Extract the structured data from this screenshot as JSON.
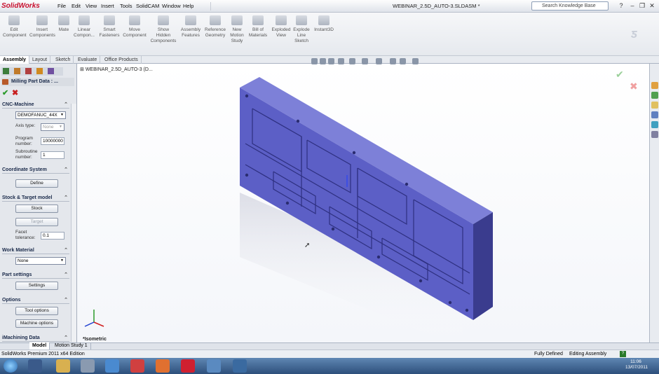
{
  "app": {
    "logo": "SolidWorks",
    "menu": [
      "File",
      "Edit",
      "View",
      "Insert",
      "Tools",
      "SolidCAM",
      "Window",
      "Help"
    ],
    "document_title": "WEBINAR_2.5D_AUTO-3.SLDASM *",
    "search_placeholder": "Search Knowledge Base"
  },
  "commands": [
    {
      "label": "Edit\nComponent"
    },
    {
      "label": "Insert\nComponents"
    },
    {
      "label": "Mate"
    },
    {
      "label": "Linear\nCompon..."
    },
    {
      "label": "Smart\nFasteners"
    },
    {
      "label": "Move\nComponent"
    },
    {
      "label": "Show\nHidden\nComponents"
    },
    {
      "label": "Assembly\nFeatures"
    },
    {
      "label": "Reference\nGeometry"
    },
    {
      "label": "New\nMotion\nStudy"
    },
    {
      "label": "Bill of\nMaterials"
    },
    {
      "label": "Exploded\nView"
    },
    {
      "label": "Explode\nLine\nSketch"
    },
    {
      "label": "Instant3D"
    }
  ],
  "tabs": [
    "Assembly",
    "Layout",
    "Sketch",
    "Evaluate",
    "Office Products"
  ],
  "panel": {
    "title": "Milling Part Data : ...",
    "sections": {
      "cnc_machine": "CNC-Machine",
      "coordinate_system": "Coordinate System",
      "stock_target": "Stock & Target model",
      "work_material": "Work Material",
      "part_settings": "Part settings",
      "options": "Options",
      "imachining": "iMachining Data"
    },
    "machine_value": "DEMOFANUC_44X",
    "axis_type_label": "Axis type:",
    "axis_type_value": "None",
    "program_number_label": "Program\nnumber:",
    "program_number_value": "10000000",
    "subroutine_label": "Subroutine\nnumber:",
    "subroutine_value": "1",
    "define_button": "Define",
    "stock_button": "Stock",
    "target_button": "Target",
    "facet_label": "Facet\ntolerance:",
    "facet_value": "0.1",
    "material_value": "None",
    "settings_button": "Settings",
    "tool_options_button": "Tool options",
    "machine_options_button": "Machine options"
  },
  "viewport": {
    "tree_root": "WEBINAR_2.5D_AUTO-3 (D...",
    "view_label": "*Isometric"
  },
  "bottom_tabs": [
    "Model",
    "Motion Study 1"
  ],
  "status": {
    "left": "SolidWorks Premium 2011 x64 Edition",
    "defined": "Fully Defined",
    "mode": "Editing Assembly"
  },
  "clock": {
    "time": "11:06",
    "date": "13/07/2011"
  },
  "colors": {
    "part": "#5c5fc6",
    "part_dark": "#3a3c8e",
    "accent": "#1f4e8c"
  }
}
